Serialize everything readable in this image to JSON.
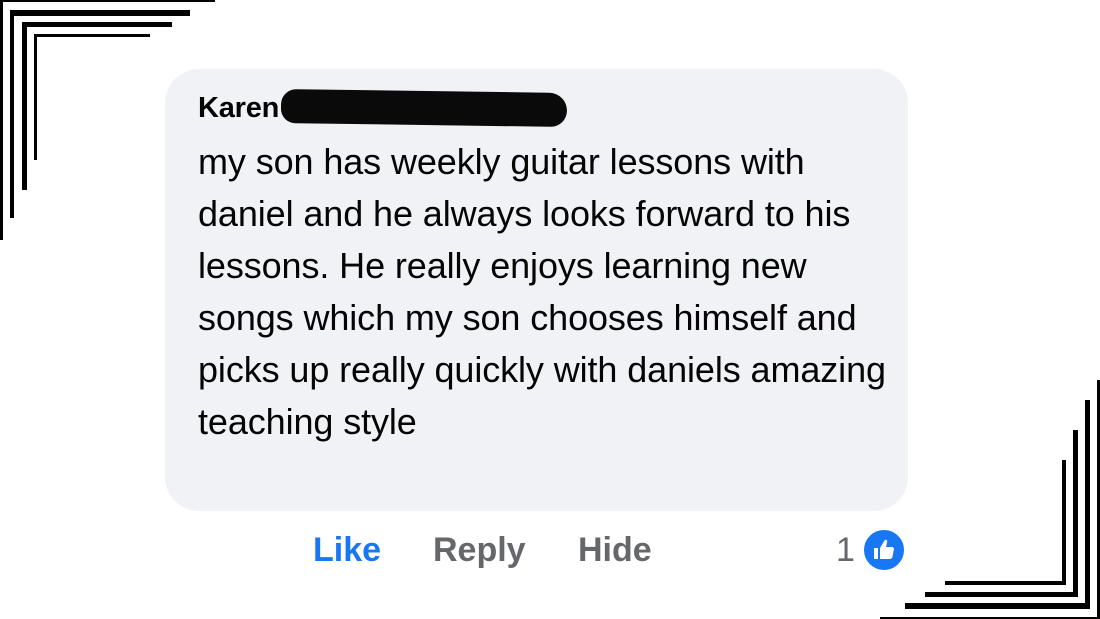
{
  "comment": {
    "author": "Karen",
    "text": "my son has weekly guitar lessons with daniel and he always looks forward to his lessons. He really enjoys learning new songs which my son chooses himself and picks up really quickly with daniels amazing teaching style"
  },
  "actions": {
    "like": "Like",
    "reply": "Reply",
    "hide": "Hide"
  },
  "reactions": {
    "count": "1",
    "icon": "thumbs-up-icon"
  },
  "colors": {
    "bubble": "#f0f2f5",
    "like_blue": "#1877f2",
    "secondary_text": "#65676b",
    "primary_text": "#050505"
  }
}
